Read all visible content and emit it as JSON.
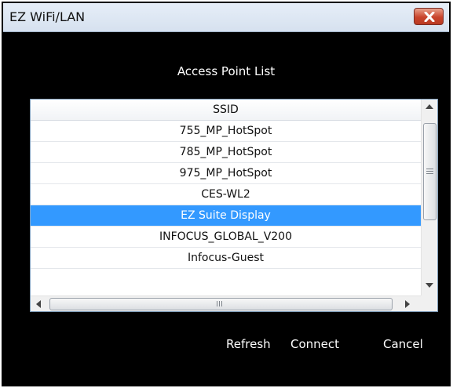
{
  "window": {
    "title": "EZ WiFi/LAN"
  },
  "heading": "Access Point List",
  "list": {
    "header": "SSID",
    "rows": [
      "755_MP_HotSpot",
      "785_MP_HotSpot",
      "975_MP_HotSpot",
      "CES-WL2",
      "EZ Suite Display",
      "INFOCUS_GLOBAL_V200",
      "Infocus-Guest"
    ],
    "selected": "EZ Suite Display"
  },
  "buttons": {
    "refresh": "Refresh",
    "connect": "Connect",
    "cancel": "Cancel"
  },
  "colors": {
    "selection": "#3399ff",
    "background": "#000000",
    "close": "#c9442c"
  },
  "icons": [
    "close-icon",
    "scroll-up-arrow-icon",
    "scroll-down-arrow-icon",
    "scroll-left-arrow-icon",
    "scroll-right-arrow-icon"
  ]
}
